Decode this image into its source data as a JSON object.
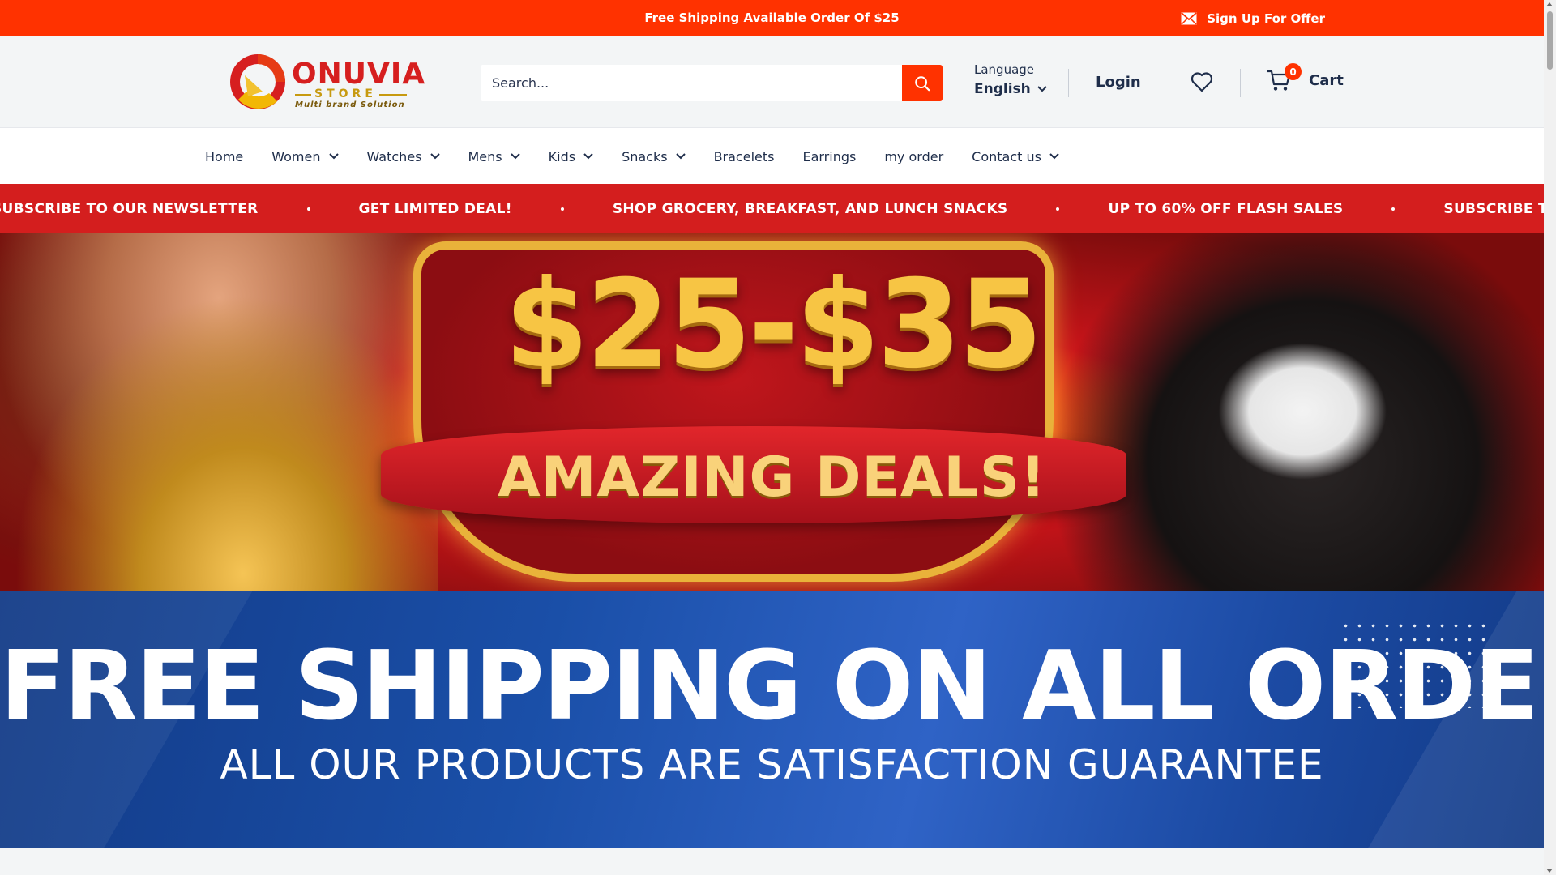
{
  "announcement": {
    "message": "Free Shipping Available Order Of $25",
    "signup_label": "Sign Up For Offer",
    "signup_icon": "mail-icon"
  },
  "header": {
    "logo": {
      "brand": "ONUVIA",
      "store": "STORE",
      "tagline": "Multi brand Solution"
    },
    "search": {
      "placeholder": "Search...",
      "value": "",
      "icon": "search-icon"
    },
    "language": {
      "label": "Language",
      "value": "English"
    },
    "login_label": "Login",
    "wishlist_icon": "heart-icon",
    "cart": {
      "label": "Cart",
      "count": "0",
      "icon": "cart-icon"
    }
  },
  "nav": {
    "items": [
      {
        "label": "Home",
        "dropdown": false
      },
      {
        "label": "Women",
        "dropdown": true
      },
      {
        "label": "Watches",
        "dropdown": true
      },
      {
        "label": "Mens",
        "dropdown": true
      },
      {
        "label": "Kids",
        "dropdown": true
      },
      {
        "label": "Snacks",
        "dropdown": true
      },
      {
        "label": "Bracelets",
        "dropdown": false
      },
      {
        "label": "Earrings",
        "dropdown": false
      },
      {
        "label": "my order",
        "dropdown": false
      },
      {
        "label": "Contact us",
        "dropdown": true
      }
    ]
  },
  "marquee": {
    "items": [
      "SUBSCRIBE TO OUR NEWSLETTER",
      "GET LIMITED DEAL!",
      "SHOP GROCERY, BREAKFAST, AND LUNCH SNACKS",
      "UP TO 60% OFF FLASH SALES",
      "SUBSCRIBE TO OUR NEWSLETTER"
    ]
  },
  "banner_deals": {
    "price_range": "$25-$35",
    "headline": "AMAZING DEALS!"
  },
  "banner_shipping": {
    "headline": "FREE SHIPPING ON ALL ORDER",
    "subline": "ALL OUR PRODUCTS ARE SATISFACTION GUARANTEE"
  },
  "colors": {
    "accent": "#ff3200",
    "marquee_bg": "#d41e1e",
    "text_dark": "#1e2d4a",
    "shipping_bg": "#1a4fa8"
  }
}
